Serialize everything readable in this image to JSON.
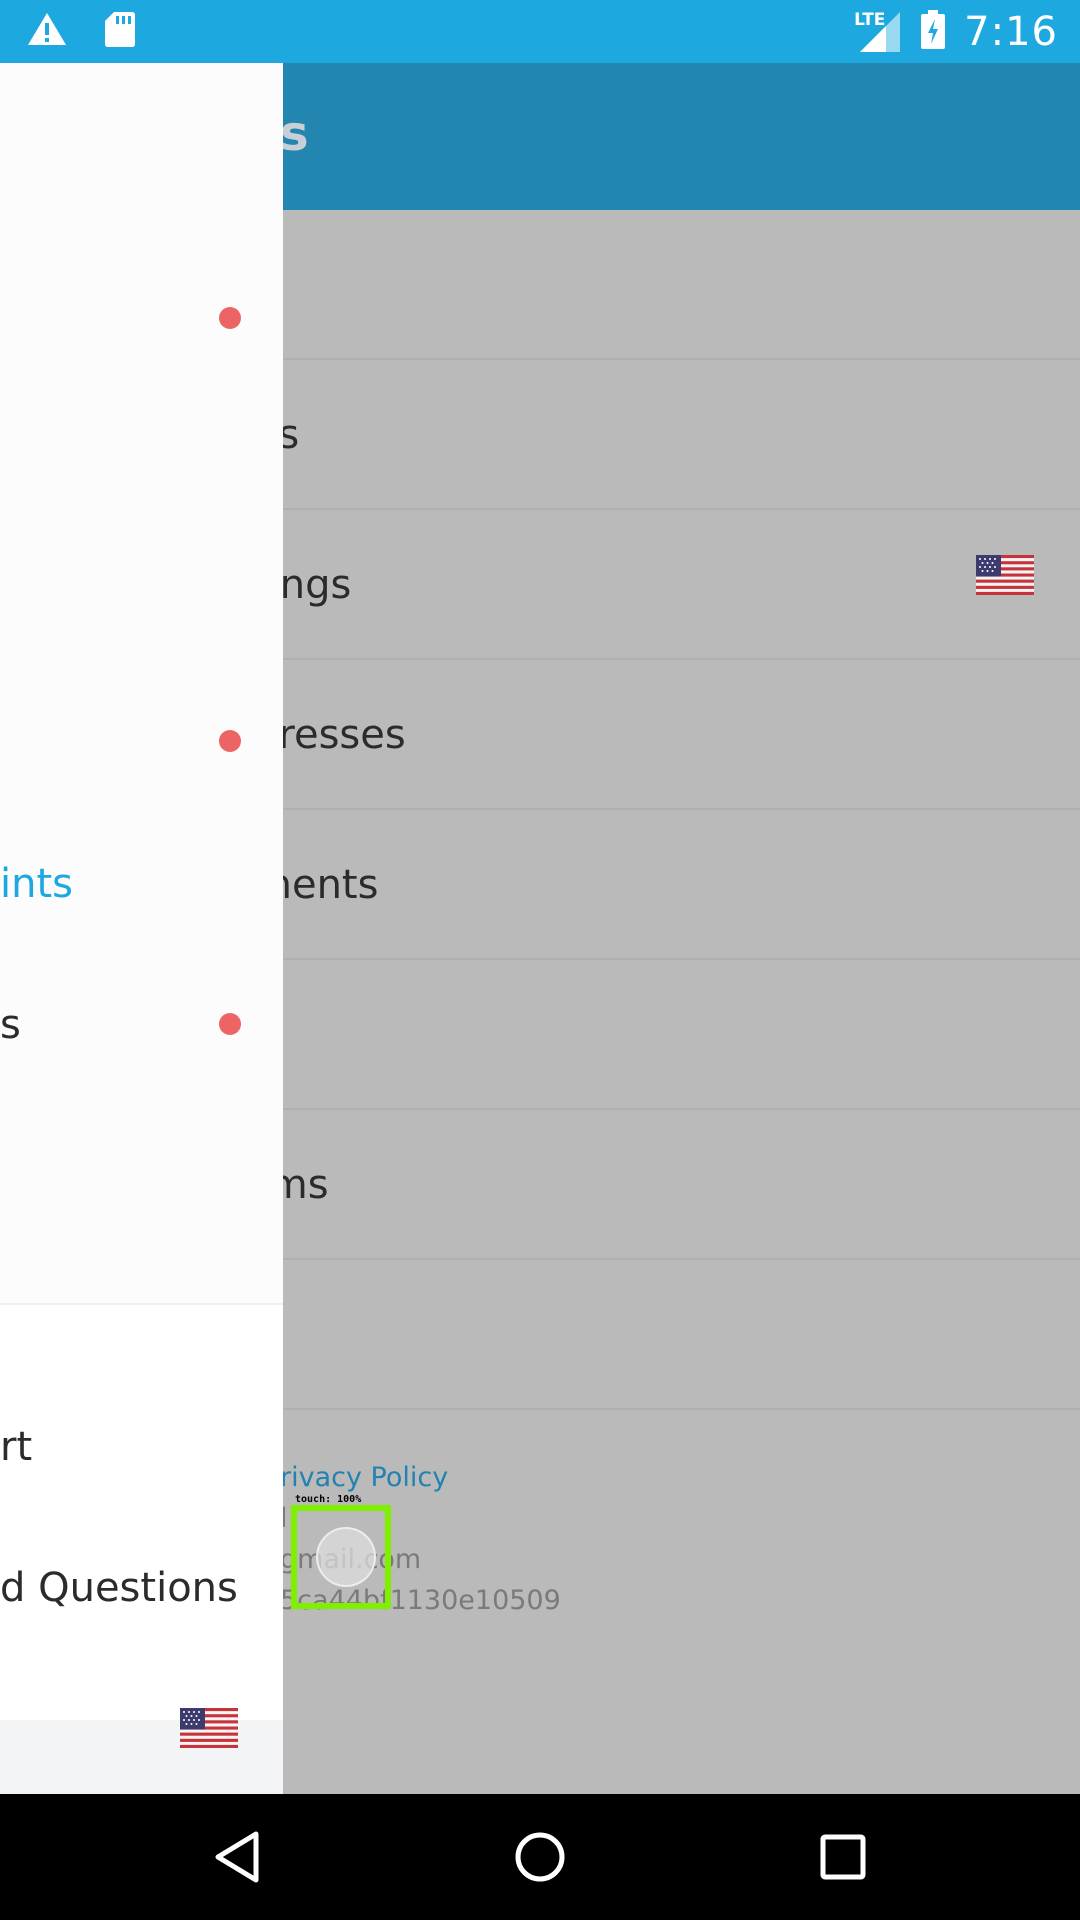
{
  "status_bar": {
    "time": "7:16",
    "network": "LTE",
    "icons": [
      "warning-icon",
      "sd-card-icon",
      "signal-icon",
      "battery-charging-icon"
    ]
  },
  "background": {
    "title": "ings",
    "rows": [
      {
        "label": ""
      },
      {
        "label": "gs"
      },
      {
        "label": "tings"
      },
      {
        "label": "dresses"
      },
      {
        "label": "ments"
      },
      {
        "label": ""
      },
      {
        "label": "rms"
      },
      {
        "label": ""
      }
    ],
    "footer": {
      "privacy_link": "rivacy Policy",
      "line2": "l",
      "email": "gmail.com",
      "id": "5ca44bf1130e10509"
    },
    "touch_label": "touch: 100%"
  },
  "drawer": {
    "items": [
      {
        "label": ""
      },
      {
        "label": ""
      },
      {
        "label": ""
      },
      {
        "label": "ints"
      },
      {
        "label": "s"
      }
    ],
    "lower_items": [
      {
        "label": "rt"
      },
      {
        "label": "d Questions"
      }
    ]
  },
  "nav": {
    "icons": [
      "back-icon",
      "home-icon",
      "recents-icon"
    ]
  },
  "colors": {
    "status_bar": "#1ea8e0",
    "app_bar": "#2386b0",
    "accent": "#1ea8e0",
    "badge": "#ec6464"
  }
}
